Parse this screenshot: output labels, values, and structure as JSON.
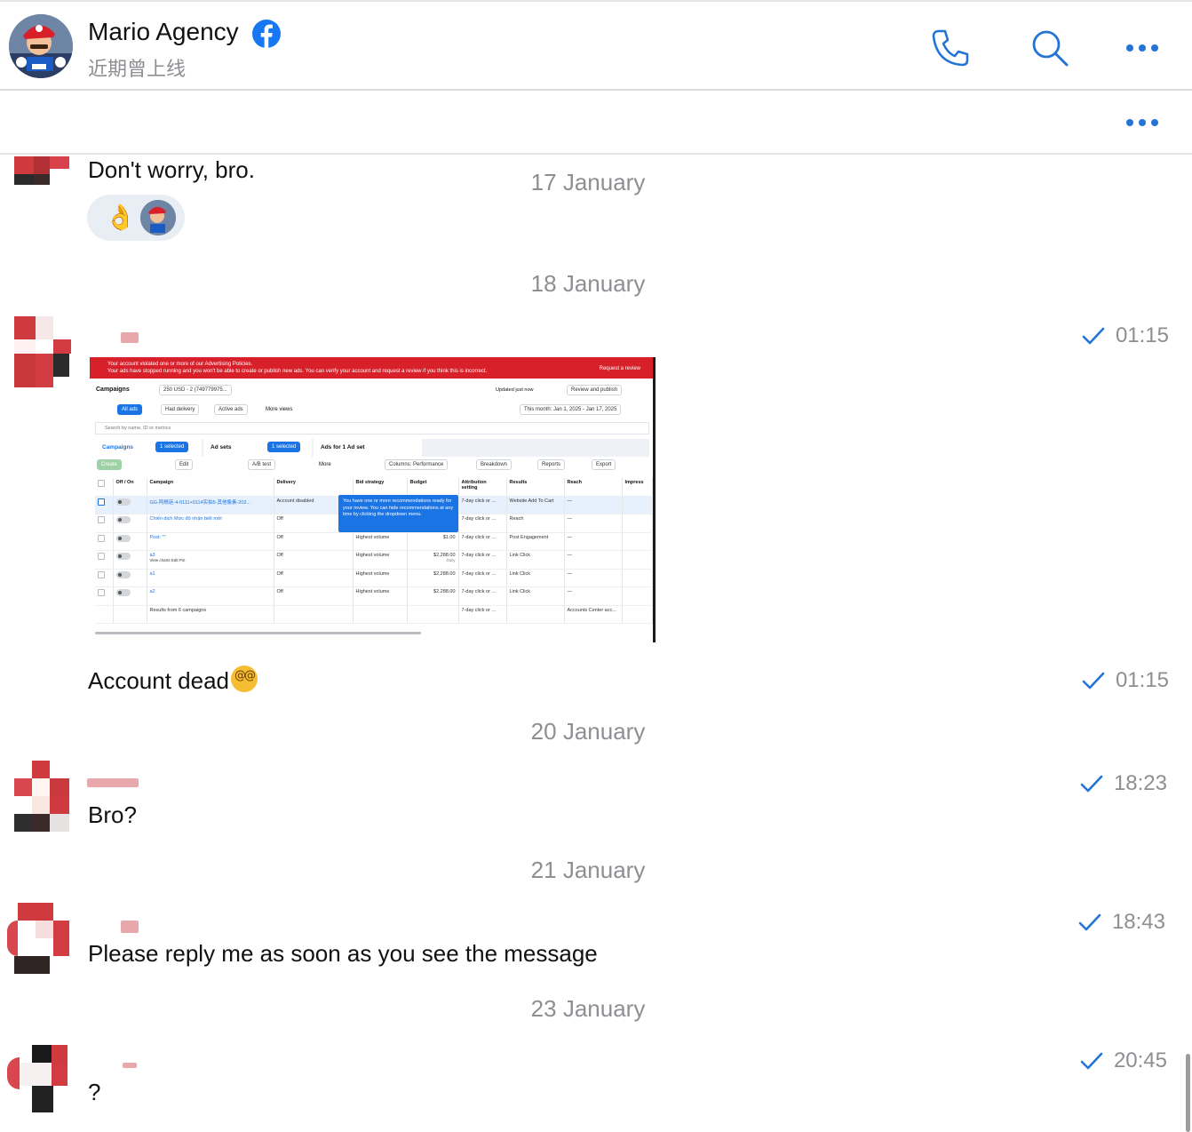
{
  "header": {
    "title": "Mario Agency",
    "status": "近期曾上线"
  },
  "colors": {
    "accent": "#2474d6",
    "muted": "#8e8e93",
    "ads_red": "#d8202b",
    "ads_blue": "#1b74e4"
  },
  "messages": [
    {
      "text": "Don't worry, bro.",
      "reaction": "👌"
    },
    {
      "date": "17 January"
    },
    {
      "date": "18 January"
    },
    {
      "time": "01:15",
      "attachment": "screenshot"
    },
    {
      "text": "Account dead",
      "time": "01:15"
    },
    {
      "date": "20 January"
    },
    {
      "text": "Bro?",
      "time": "18:23"
    },
    {
      "date": "21 January"
    },
    {
      "text": "Please reply me as soon as you see the message",
      "time": "18:43"
    },
    {
      "date": "23 January"
    },
    {
      "text": "?",
      "time": "20:45"
    }
  ],
  "screenshot": {
    "banner_title": "Your account violated one or more of our Advertising Policies.",
    "banner_body": "Your ads have stopped running and you won't be able to create or publish new ads. You can verify your account and request a review if you think this is incorrect.",
    "banner_action": "Request a review",
    "campaigns_label": "Campaigns",
    "account": "250 USD - 2 (749779975...",
    "updated": "Updated just now",
    "review_publish": "Review and publish",
    "filters": [
      "All ads",
      "Had delivery",
      "Active ads",
      "More views"
    ],
    "date_range": "This month: Jan 1, 2025 - Jan 17, 2025",
    "search_placeholder": "Search by name, ID or metrics",
    "tabs": [
      "Campaigns",
      "Ad sets",
      "Ads for 1 Ad set"
    ],
    "selected_badge": "1 selected",
    "toolbar": [
      "Create",
      "Edit",
      "A/B test",
      "More",
      "Columns: Performance",
      "Breakdown",
      "Reports",
      "Export"
    ],
    "columns": [
      "Off / On",
      "Campaign",
      "Delivery",
      "Bid strategy",
      "Budget",
      "Attribution setting",
      "Results",
      "Reach",
      "Impress"
    ],
    "rows": [
      {
        "name": "GG-阿根廷-4-0111+0114实拍5-其他像素-202...",
        "delivery": "Account disabled",
        "bid": "",
        "budget": "",
        "attr": "7-day click or ...",
        "results": "Website Add To Cart",
        "reach": "—"
      },
      {
        "name": "Chiến dịch Mức độ nhận biết mới",
        "delivery": "Off",
        "bid": "",
        "budget": "",
        "attr": "7-day click or ...",
        "results": "Reach",
        "reach": "—"
      },
      {
        "name": "Post: \"\"",
        "delivery": "Off",
        "bid": "Highest volume",
        "budget": "$1.00",
        "attr": "7-day click or ...",
        "results": "Post Engagement",
        "reach": "—"
      },
      {
        "name": "a3",
        "delivery": "Off",
        "bid": "Highest volume",
        "budget": "$2,288.00",
        "attr": "7-day click or ...",
        "results": "Link Click",
        "reach": "—"
      },
      {
        "name": "a1",
        "delivery": "Off",
        "bid": "Highest volume",
        "budget": "$2,288.00",
        "attr": "7-day click or ...",
        "results": "Link Click",
        "reach": "—"
      },
      {
        "name": "a2",
        "delivery": "Off",
        "bid": "Highest volume",
        "budget": "$2,288.00",
        "attr": "7-day click or ...",
        "results": "Link Click",
        "reach": "—"
      }
    ],
    "row_actions": "View charts  Edit  Pin",
    "budget_sub": "Daily",
    "footer": "Results from 6 campaigns",
    "footer_attr": "7-day click or ...",
    "footer_reach": "Accounts Center acc...",
    "tooltip": "You have one or more recommendations ready for your review. You can hide recommendations at any time by clicking the dropdown menu."
  }
}
